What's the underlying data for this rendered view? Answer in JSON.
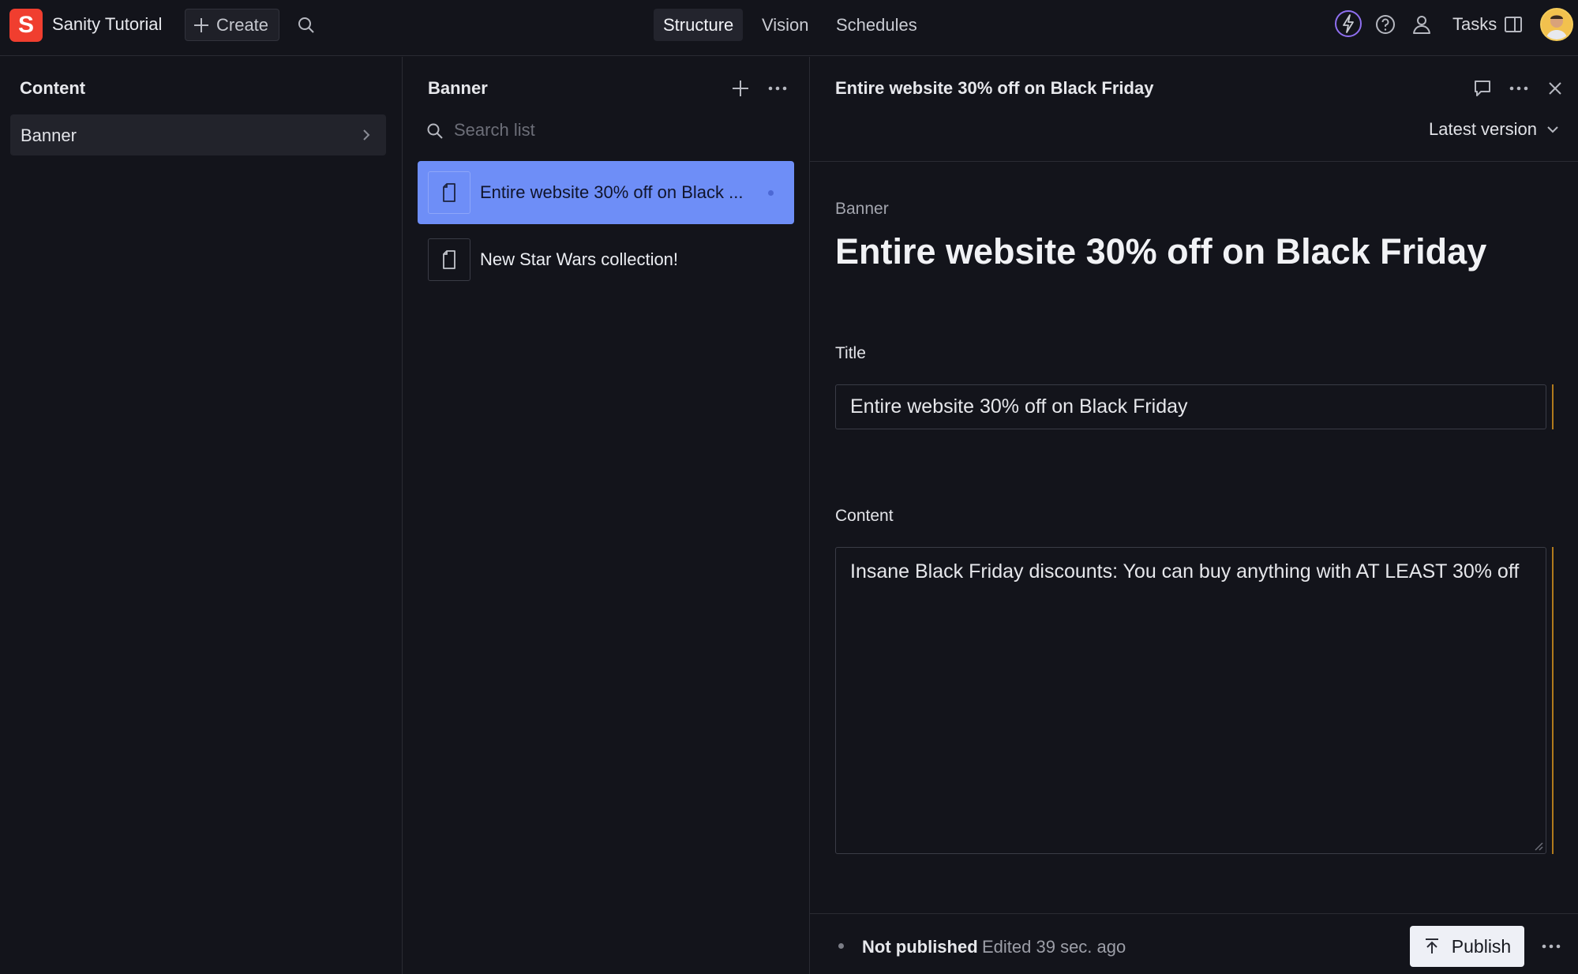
{
  "navbar": {
    "logo_letter": "S",
    "app_title": "Sanity Tutorial",
    "create_label": "Create",
    "tabs": [
      {
        "label": "Structure",
        "active": true
      },
      {
        "label": "Vision",
        "active": false
      },
      {
        "label": "Schedules",
        "active": false
      }
    ],
    "tasks_label": "Tasks",
    "icons": [
      "search-icon",
      "bolt-icon",
      "help-icon",
      "users-icon",
      "panel-icon",
      "avatar"
    ]
  },
  "content_pane": {
    "title": "Content",
    "items": [
      {
        "label": "Banner"
      }
    ]
  },
  "list_pane": {
    "title": "Banner",
    "search_placeholder": "Search list",
    "items": [
      {
        "label": "Entire website 30% off on Black ...",
        "selected": true
      },
      {
        "label": "New Star Wars collection!",
        "selected": false
      }
    ]
  },
  "document": {
    "header_title": "Entire website 30% off on Black Friday",
    "version_label": "Latest version",
    "type_label": "Banner",
    "title": "Entire website 30% off on Black Friday",
    "fields": {
      "title_label": "Title",
      "title_value": "Entire website 30% off on Black Friday",
      "content_label": "Content",
      "content_value": "Insane Black Friday discounts: You can buy anything with AT LEAST 30% off"
    }
  },
  "footer": {
    "status": "Not published",
    "edited": "Edited 39 sec. ago",
    "publish_label": "Publish"
  },
  "colors": {
    "background": "#13141b",
    "accent_selected": "#6e8ef7",
    "brand": "#f03e2f",
    "change_indicator": "#b07a1c"
  }
}
